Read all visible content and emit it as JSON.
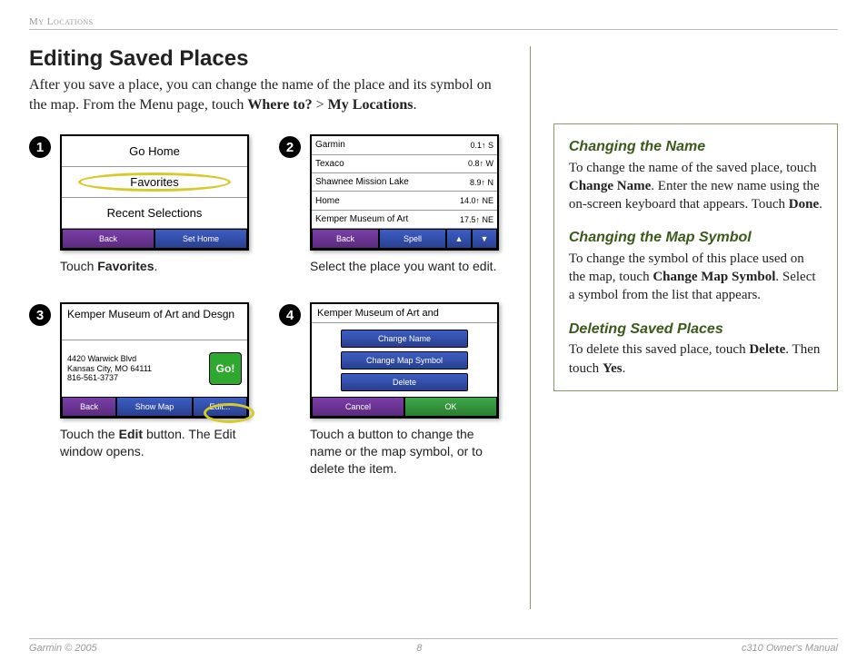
{
  "header": {
    "section": "My Locations"
  },
  "title": "Editing Saved Places",
  "intro": {
    "pre": "After you save a place, you can change the name of the place and its symbol on the map. From the Menu page, touch ",
    "bold1": "Where to?",
    "mid": " > ",
    "bold2": "My Locations",
    "post": "."
  },
  "steps": {
    "s1": {
      "rows": [
        "Go Home",
        "Favorites",
        "Recent Selections"
      ],
      "nav": {
        "back": "Back",
        "right": "Set Home"
      },
      "caption_pre": "Touch ",
      "caption_bold": "Favorites",
      "caption_post": "."
    },
    "s2": {
      "list": [
        {
          "name": "Garmin",
          "dist": "0.1↑ S"
        },
        {
          "name": "Texaco",
          "dist": "0.8↑ W"
        },
        {
          "name": "Shawnee Mission Lake",
          "dist": "8.9↑ N"
        },
        {
          "name": "Home",
          "dist": "14.0↑ NE"
        },
        {
          "name": "Kemper Museum of Art",
          "dist": "17.5↑ NE"
        }
      ],
      "nav": {
        "back": "Back",
        "spell": "Spell",
        "up": "▲",
        "down": "▼"
      },
      "caption": "Select the place you want to edit."
    },
    "s3": {
      "title": "Kemper Museum of Art and Desgn",
      "addr1": "4420 Warwick Blvd",
      "addr2": "Kansas City, MO 64111",
      "addr3": "816-561-3737",
      "go": "Go!",
      "nav": {
        "back": "Back",
        "map": "Show Map",
        "edit": "Edit..."
      },
      "caption_pre": "Touch the ",
      "caption_bold": "Edit",
      "caption_post": " button. The Edit window opens."
    },
    "s4": {
      "title": "Kemper Museum of Art and",
      "btn1": "Change Name",
      "btn2": "Change Map Symbol",
      "btn3": "Delete",
      "nav": {
        "cancel": "Cancel",
        "ok": "OK"
      },
      "caption": "Touch a button to change the name or the map symbol, or to delete the item."
    }
  },
  "sidebar": {
    "h1": "Changing the Name",
    "p1_pre": "To change the name of the saved place, touch ",
    "p1_b1": "Change Name",
    "p1_mid": ". Enter the new name using the on-screen keyboard that appears. Touch ",
    "p1_b2": "Done",
    "p1_post": ".",
    "h2": "Changing the Map Symbol",
    "p2_pre": "To change the symbol of this place used on the map, touch ",
    "p2_b": "Change Map Symbol",
    "p2_post": ". Select a symbol from the list that appears.",
    "h3": "Deleting Saved Places",
    "p3_pre": "To delete this saved place, touch ",
    "p3_b1": "Delete",
    "p3_mid": ". Then touch ",
    "p3_b2": "Yes",
    "p3_post": "."
  },
  "footer": {
    "left": "Garmin © 2005",
    "center": "8",
    "right": "c310 Owner's Manual"
  }
}
